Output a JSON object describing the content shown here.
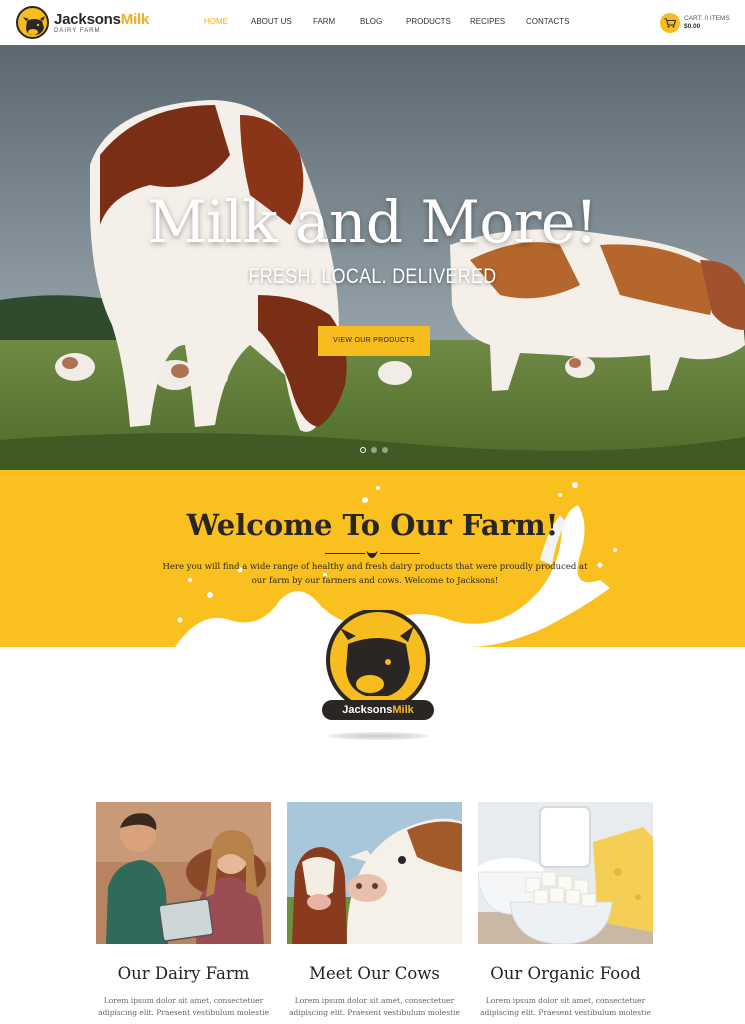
{
  "header": {
    "logo": {
      "name_dark": "Jacksons",
      "name_accent": "Milk",
      "subtitle": "DAIRY FARM"
    },
    "nav": [
      {
        "label": "HOME",
        "active": true
      },
      {
        "label": "ABOUT US",
        "active": false
      },
      {
        "label": "FARM",
        "active": false
      },
      {
        "label": "BLOG",
        "active": false
      },
      {
        "label": "PRODUCTS",
        "active": false
      },
      {
        "label": "RECIPES",
        "active": false
      },
      {
        "label": "CONTACTS",
        "active": false
      }
    ],
    "cart": {
      "label": "CART: 0 ITEMS",
      "total": "$0.00",
      "icon": "cart-icon"
    }
  },
  "hero": {
    "title": "Milk and More!",
    "subtitle": "FRESH. LOCAL. DELIVERED",
    "button_label": "VIEW OUR PRODUCTS",
    "slides": 3,
    "active_slide": 1
  },
  "welcome": {
    "title": "Welcome To Our Farm!",
    "text": "Here you will find a wide range of healthy and fresh dairy products that were proudly produced at our farm by our farmers and cows. Welcome to Jacksons!"
  },
  "badge": {
    "name_light": "Jacksons",
    "name_accent": "Milk"
  },
  "cards": [
    {
      "title": "Our Dairy Farm",
      "text": "Lorem ipsum dolor sit amet, consectetuer adipiscing elit. Praesent vestibulum molestie"
    },
    {
      "title": "Meet Our Cows",
      "text": "Lorem ipsum dolor sit amet, consectetuer adipiscing elit. Praesent vestibulum molestie"
    },
    {
      "title": "Our Organic Food",
      "text": "Lorem ipsum dolor sit amet, consectetuer adipiscing elit. Praesent vestibulum molestie"
    }
  ],
  "colors": {
    "accent": "#f9c01f",
    "dark": "#2a2624",
    "nav_active": "#f2b01e"
  }
}
